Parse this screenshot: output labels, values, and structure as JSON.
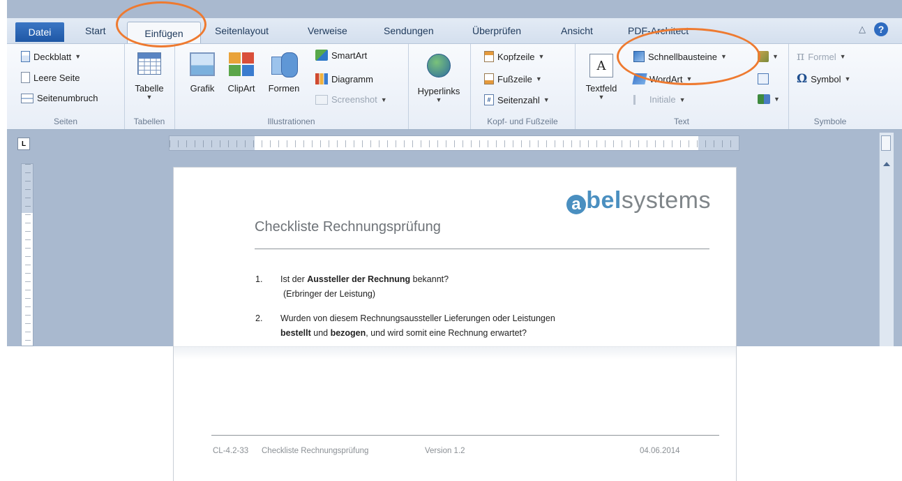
{
  "ribbon_tabs": {
    "file": "Datei",
    "start": "Start",
    "insert": "Einfügen",
    "page_layout": "Seitenlayout",
    "references": "Verweise",
    "mailings": "Sendungen",
    "review": "Überprüfen",
    "view": "Ansicht",
    "pdf": "PDF-Architect",
    "minimize": "△",
    "help": "?"
  },
  "groups": {
    "pages": {
      "label": "Seiten",
      "cover": "Deckblatt",
      "blank": "Leere Seite",
      "break": "Seitenumbruch"
    },
    "tables": {
      "label": "Tabellen",
      "table": "Tabelle"
    },
    "illustrations": {
      "label": "Illustrationen",
      "picture": "Grafik",
      "clipart": "ClipArt",
      "shapes": "Formen",
      "smartart": "SmartArt",
      "chart": "Diagramm",
      "screenshot": "Screenshot"
    },
    "links": {
      "label": "",
      "hyperlinks": "Hyperlinks"
    },
    "header_footer": {
      "label": "Kopf- und Fußzeile",
      "header": "Kopfzeile",
      "footer": "Fußzeile",
      "page_number": "Seitenzahl"
    },
    "text": {
      "label": "Text",
      "textbox": "Textfeld",
      "quickparts": "Schnellbausteine",
      "wordart": "WordArt",
      "dropcap": "Initiale"
    },
    "symbols": {
      "label": "Symbole",
      "formula": "Formel",
      "symbol": "Symbol"
    }
  },
  "document": {
    "logo_letter": "a",
    "logo_bold": "bel",
    "logo_rest": "systems",
    "title": "Checkliste Rechnungsprüfung",
    "items": [
      {
        "num": "1.",
        "line1_pre": "Ist der ",
        "line1_bold": "Aussteller der Rechnung",
        "line1_post": " bekannt?",
        "line2": "(Erbringer der Leistung)"
      },
      {
        "num": "2.",
        "line1": "Wurden von diesem Rechnungsaussteller Lieferungen oder Leistungen",
        "line2_bold1": "bestellt",
        "line2_mid": " und ",
        "line2_bold2": "bezogen",
        "line2_post": ", und wird somit eine Rechnung erwartet?"
      }
    ],
    "footer": {
      "doc_id": "CL-4.2-33",
      "doc_name": "Checkliste Rechnungsprüfung",
      "version": "Version 1.2",
      "date": "04.06.2014"
    }
  },
  "colors": {
    "annotation": "#ee7a30",
    "file_tab": "#2a63b0",
    "logo_blue": "#4a8fc0"
  }
}
